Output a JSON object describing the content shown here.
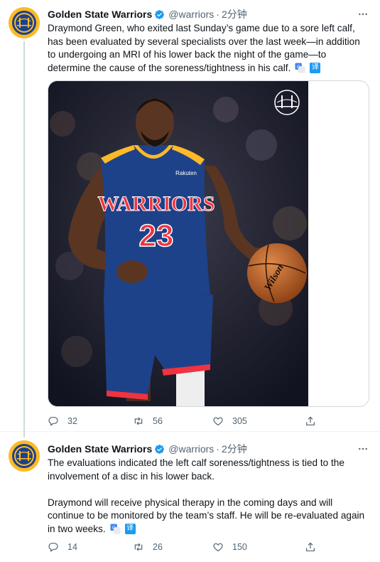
{
  "tweets": [
    {
      "author": {
        "name": "Golden State Warriors",
        "handle": "@warriors"
      },
      "separator": "·",
      "time": "2分钟",
      "paragraphs": [
        "Draymond Green, who exited last Sunday’s game due to a sore left calf, has been evaluated by several specialists over the last week—in addition to undergoing an MRI of his lower back the night of the game—to determine the cause of the soreness/tightness in his calf."
      ],
      "translate_label": "译",
      "photo": {
        "jersey_text": "WARRIORS",
        "jersey_number": "23",
        "sponsor_text": "Rakuten",
        "ball_text": "Wilson",
        "logo": "golden-gate-bridge-logo"
      },
      "stats": {
        "replies": "32",
        "retweets": "56",
        "likes": "305"
      }
    },
    {
      "author": {
        "name": "Golden State Warriors",
        "handle": "@warriors"
      },
      "separator": "·",
      "time": "2分钟",
      "paragraphs": [
        "The evaluations indicated the left calf soreness/tightness is tied to the involvement of a disc in his lower back.",
        "Draymond will receive physical therapy in the coming days and will continue to be monitored by the team’s staff. He will be re-evaluated again in two weeks."
      ],
      "translate_label": "译",
      "stats": {
        "replies": "14",
        "retweets": "26",
        "likes": "150"
      }
    }
  ],
  "colors": {
    "accent": "#1d9bf0",
    "secondary_text": "#536471",
    "warriors_blue": "#1d428a",
    "warriors_gold": "#fdb927"
  },
  "icons": [
    "warriors-logo",
    "verified-badge-icon",
    "more-icon",
    "google-translate-icon",
    "reply-icon",
    "retweet-icon",
    "like-icon",
    "share-icon"
  ]
}
